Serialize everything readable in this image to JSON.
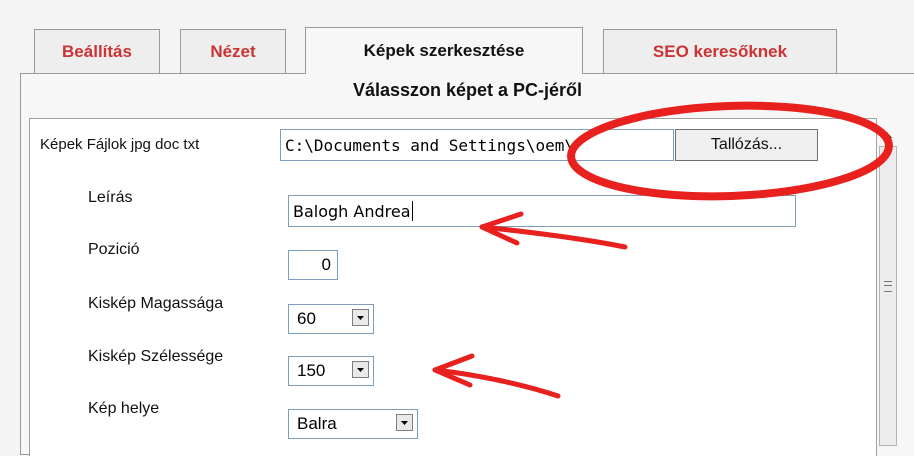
{
  "tabs": [
    {
      "label": "Beállítás",
      "active": false
    },
    {
      "label": "Nézet",
      "active": false
    },
    {
      "label": "Képek szerkesztése",
      "active": true
    },
    {
      "label": "SEO keresőknek",
      "active": false
    }
  ],
  "panel": {
    "title": "Válasszon képet a PC-jéről"
  },
  "form": {
    "file": {
      "label": "Képek Fájlok jpg doc txt",
      "value": "C:\\Documents and Settings\\oem\\",
      "browse_label": "Tallózás..."
    },
    "description": {
      "label": "Leírás",
      "value": "Balogh Andrea"
    },
    "position": {
      "label": "Pozició",
      "value": "0"
    },
    "thumb_height": {
      "label": "Kiskép Magassága",
      "value": "60"
    },
    "thumb_width": {
      "label": "Kiskép Szélessége",
      "value": "150"
    },
    "image_place": {
      "label": "Kép helye",
      "value": "Balra"
    }
  },
  "annotations": {
    "color": "#e8201e"
  }
}
